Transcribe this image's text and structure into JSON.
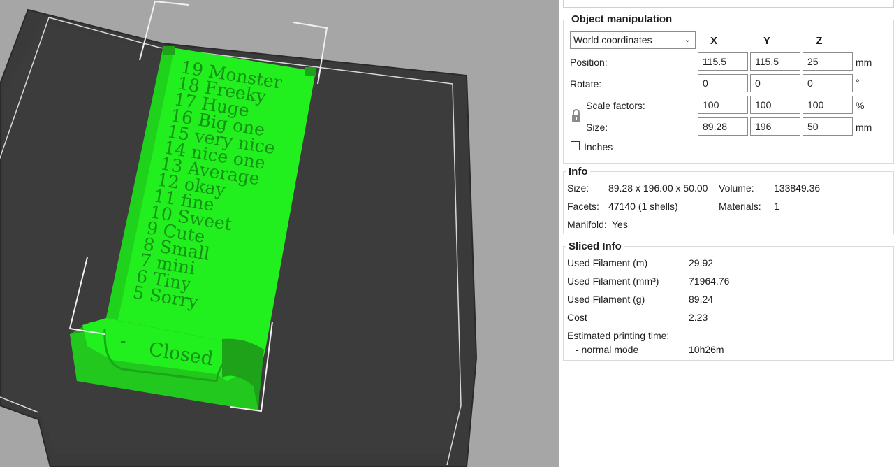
{
  "viewport": {
    "model_labels": [
      {
        "num": "19",
        "word": "Monster"
      },
      {
        "num": "18",
        "word": "Freeky"
      },
      {
        "num": "17",
        "word": "Huge"
      },
      {
        "num": "16",
        "word": "Big one"
      },
      {
        "num": "15",
        "word": "very nice"
      },
      {
        "num": "14",
        "word": "nice one"
      },
      {
        "num": "13",
        "word": "Average"
      },
      {
        "num": "12",
        "word": "okay"
      },
      {
        "num": "11",
        "word": "fine"
      },
      {
        "num": "10",
        "word": "Sweet"
      },
      {
        "num": "9",
        "word": "Cute"
      },
      {
        "num": "8",
        "word": "Small"
      },
      {
        "num": "7",
        "word": "mini"
      },
      {
        "num": "6",
        "word": "Tiny"
      },
      {
        "num": "5",
        "word": "Sorry"
      }
    ],
    "closed_label": "Closed",
    "closed_mark": "-",
    "colors": {
      "model": "#22f01e",
      "model_shade": "#1ea21a",
      "bed": "#3a3a3a",
      "background": "#a6a6a6"
    }
  },
  "object_manipulation": {
    "title": "Object manipulation",
    "coord_system": "World coordinates",
    "axes": [
      "X",
      "Y",
      "Z"
    ],
    "rows": [
      {
        "label": "Position:",
        "values": [
          "115.5",
          "115.5",
          "25"
        ],
        "unit": "mm"
      },
      {
        "label": "Rotate:",
        "values": [
          "0",
          "0",
          "0"
        ],
        "unit": "°"
      },
      {
        "label": "Scale factors:",
        "values": [
          "100",
          "100",
          "100"
        ],
        "unit": "%"
      },
      {
        "label": "Size:",
        "values": [
          "89.28",
          "196",
          "50"
        ],
        "unit": "mm"
      }
    ],
    "lock_icon": "lock-icon",
    "inches_label": "Inches"
  },
  "info": {
    "title": "Info",
    "size_label": "Size:",
    "size_value": "89.28 x 196.00 x 50.00",
    "volume_label": "Volume:",
    "volume_value": "133849.36",
    "facets_label": "Facets:",
    "facets_value": "47140 (1 shells)",
    "materials_label": "Materials:",
    "materials_value": "1",
    "manifold_label": "Manifold:",
    "manifold_value": "Yes"
  },
  "sliced_info": {
    "title": "Sliced Info",
    "rows": [
      {
        "label": "Used Filament (m)",
        "value": "29.92"
      },
      {
        "label": "Used Filament (mm³)",
        "value": "71964.76"
      },
      {
        "label": "Used Filament (g)",
        "value": "89.24"
      },
      {
        "label": "Cost",
        "value": "2.23"
      }
    ],
    "print_time_label": "Estimated printing time:",
    "mode_label": "- normal mode",
    "mode_value": "10h26m"
  }
}
